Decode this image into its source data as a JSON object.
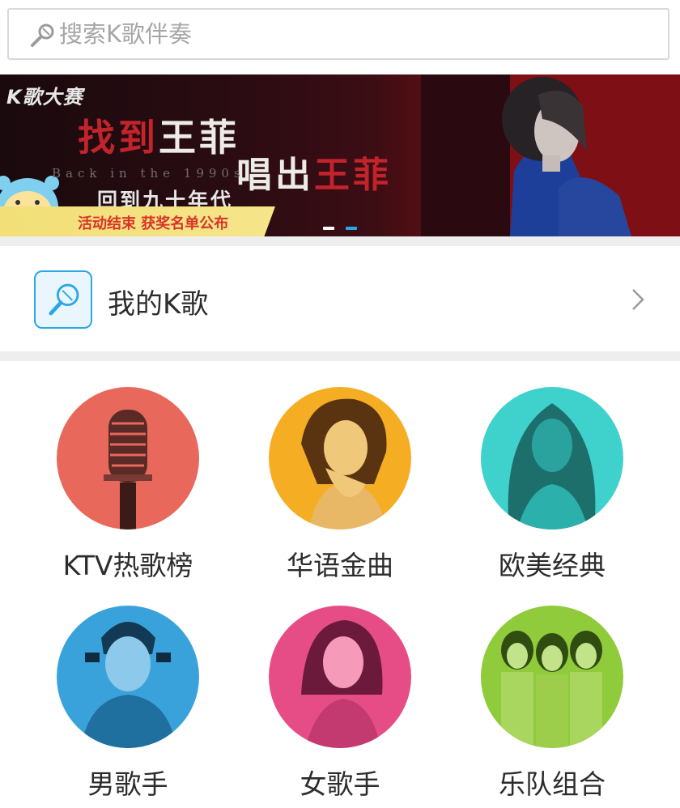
{
  "search": {
    "placeholder": "搜索K歌伴奏",
    "icon": "microphone-icon"
  },
  "banner": {
    "brand": "K歌大赛",
    "headline1_red": "找到",
    "headline1_white": "王菲",
    "headline2_white": "唱出",
    "headline2_red": "王菲",
    "english": "Back in the 1990s",
    "subtitle": "回到九十年代",
    "ribbon": "活动结束 获奖名单公布",
    "active_dot": 2,
    "dot_count": 2
  },
  "my_karaoke": {
    "label": "我的K歌",
    "icon": "microphone-icon",
    "chevron_icon": "chevron-right-icon"
  },
  "categories": [
    {
      "label": "KTV热歌榜",
      "color": "#e8685c"
    },
    {
      "label": "华语金曲",
      "color": "#f5ae24"
    },
    {
      "label": "欧美经典",
      "color": "#3fd1cc"
    },
    {
      "label": "男歌手",
      "color": "#3aa2da"
    },
    {
      "label": "女歌手",
      "color": "#e64d86"
    },
    {
      "label": "乐队组合",
      "color": "#8fcb3a"
    }
  ],
  "colors": {
    "accent": "#27a8e6",
    "divider": "#eeeeee",
    "text": "#2c2c2c",
    "placeholder": "#a6a6a6"
  }
}
